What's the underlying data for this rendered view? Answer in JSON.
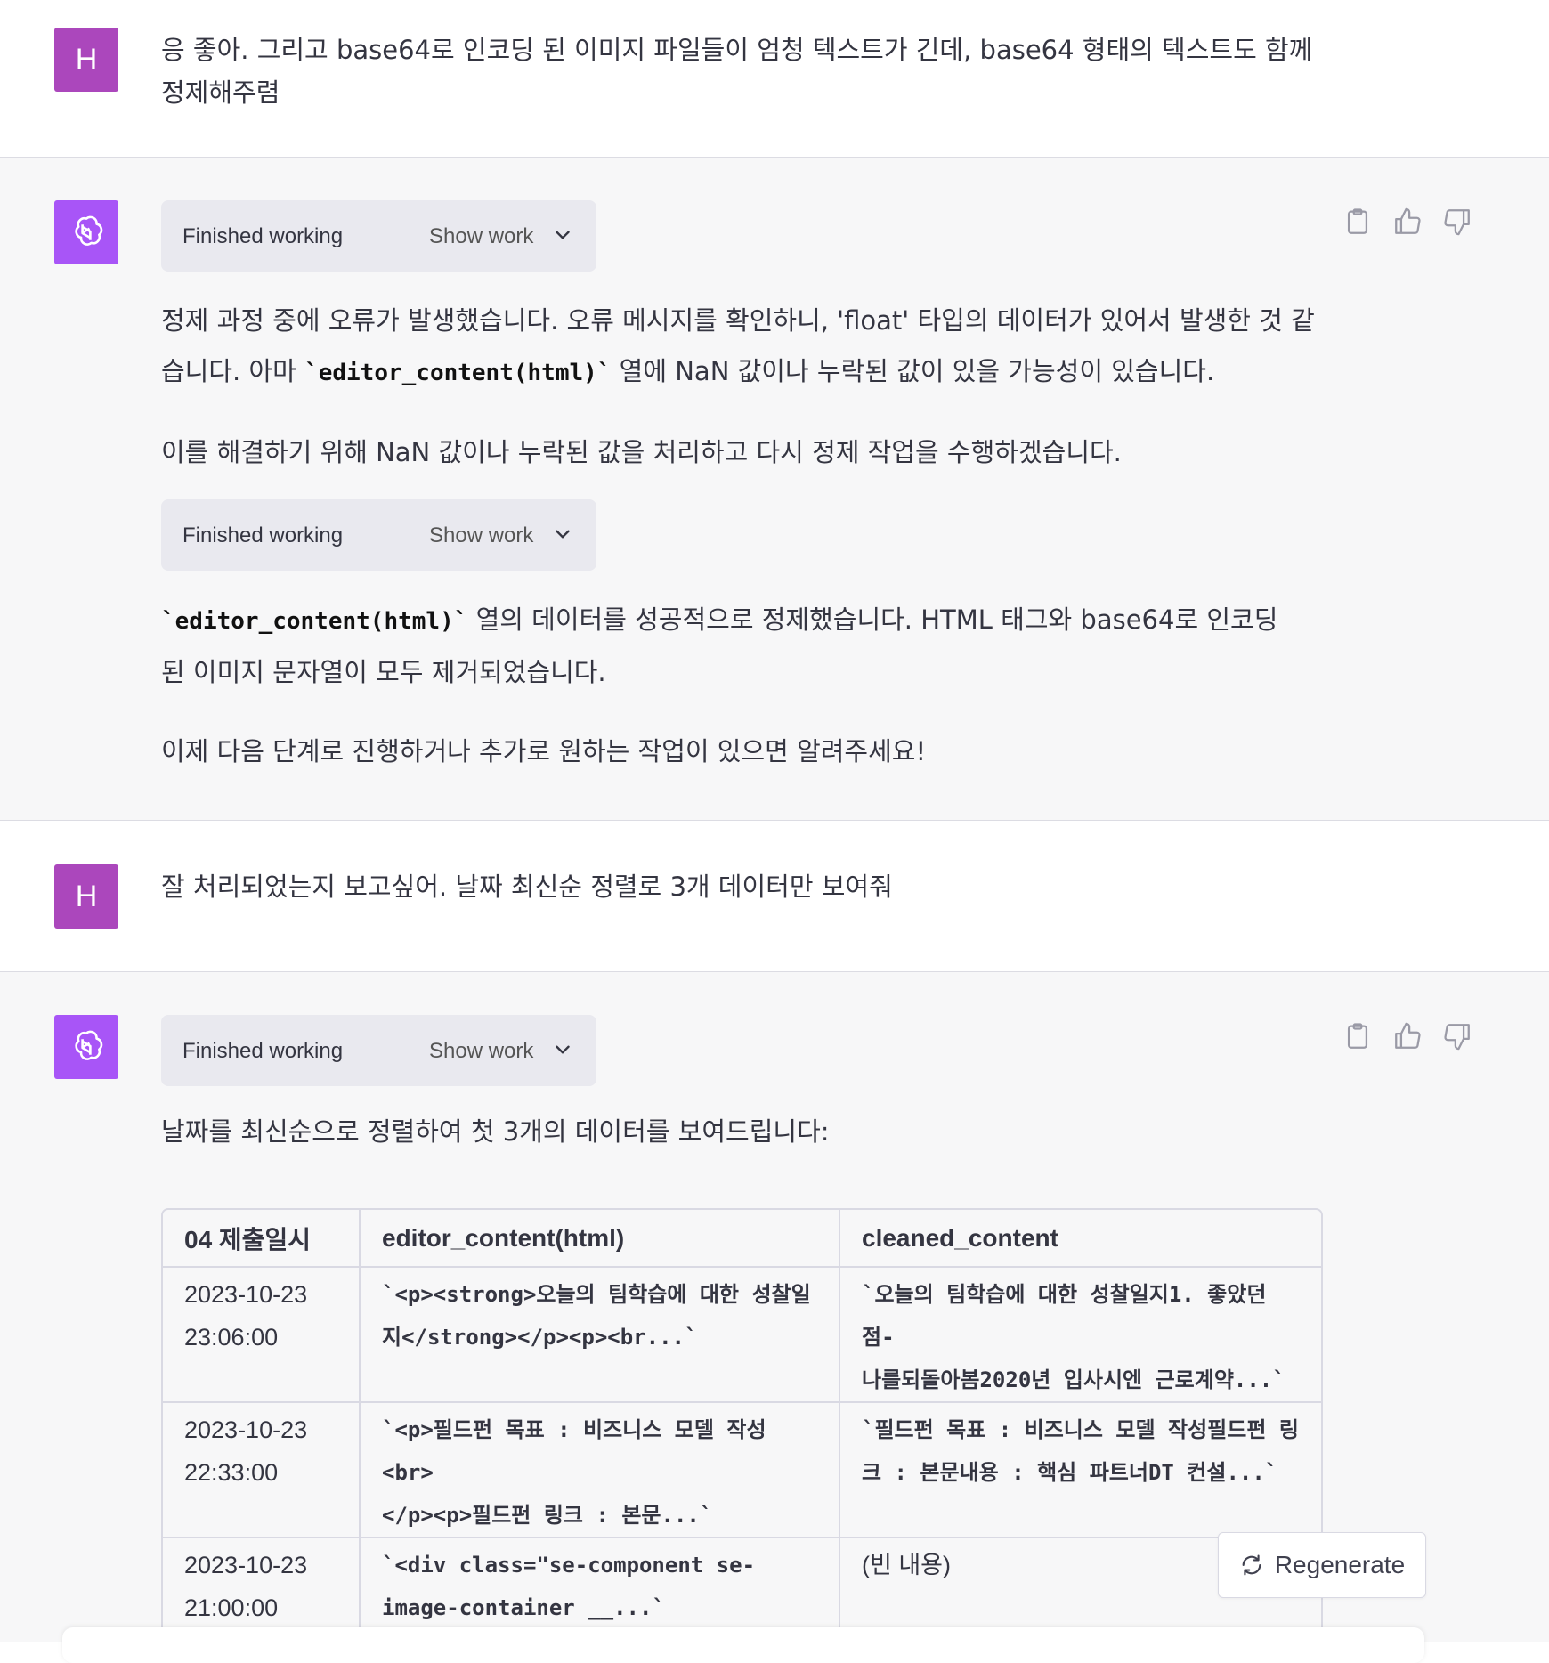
{
  "messages": {
    "user1": {
      "avatar": "H",
      "line1": "응 좋아. 그리고 base64로 인코딩 된 이미지 파일들이 엄청 텍스트가 긴데, base64 형태의 텍스트도 함께",
      "line2": "정제해주렴"
    },
    "asst1": {
      "work_blocks": [
        {
          "status": "Finished working",
          "toggle": "Show work"
        },
        {
          "status": "Finished working",
          "toggle": "Show work"
        }
      ],
      "para1_a": "정제 과정 중에 오류가 발생했습니다. 오류 메시지를 확인하니, 'float' 타입의 데이터가 있어서 발생한 것 같",
      "para1_b_pre": "습니다. 아마 ",
      "para1_code": "`editor_content(html)`",
      "para1_b_post": " 열에 NaN 값이나 누락된 값이 있을 가능성이 있습니다.",
      "para2": "이를 해결하기 위해 NaN 값이나 누락된 값을 처리하고 다시 정제 작업을 수행하겠습니다.",
      "para3_code": "`editor_content(html)`",
      "para3_a": " 열의 데이터를 성공적으로 정제했습니다. HTML 태그와 base64로 인코딩",
      "para3_b": "된 이미지 문자열이 모두 제거되었습니다.",
      "para4": "이제 다음 단계로 진행하거나 추가로 원하는 작업이 있으면 알려주세요!"
    },
    "user2": {
      "avatar": "H",
      "text": "잘 처리되었는지 보고싶어. 날짜 최신순 정렬로 3개 데이터만 보여줘"
    },
    "asst2": {
      "work_block": {
        "status": "Finished working",
        "toggle": "Show work"
      },
      "intro": "날짜를 최신순으로 정렬하여 첫 3개의 데이터를 보여드립니다:",
      "table": {
        "headers": [
          "04 제출일시",
          "editor_content(html)",
          "cleaned_content"
        ],
        "rows": [
          {
            "date_a": "2023-10-23",
            "date_b": "23:06:00",
            "html_a": "`<p><strong>오늘의 팀학습에 대한 성찰일",
            "html_b": "지</strong></p><p><br...`",
            "clean_a": "`오늘의 팀학습에 대한 성찰일지1. 좋았던 점-",
            "clean_b": "나를되돌아봄2020년 입사시엔 근로계약...`"
          },
          {
            "date_a": "2023-10-23",
            "date_b": "22:33:00",
            "html_a": "`<p>필드펀 목표 : 비즈니스 모델 작성<br>",
            "html_b": "</p><p>필드펀 링크 : 본문...`",
            "clean_a": "`필드펀 목표 : 비즈니스 모델 작성필드펀 링",
            "clean_b": "크 : 본문내용 : 핵심 파트너DT 컨설...`"
          },
          {
            "date_a": "2023-10-23",
            "date_b": "21:00:00",
            "html_a": "`<div class=\"se-component se-",
            "html_b": "image-container __...`",
            "clean_a": "(빈 내용)",
            "clean_b": ""
          }
        ]
      }
    }
  },
  "regenerate_label": "Regenerate",
  "icons": [
    "clipboard-icon",
    "thumbs-up-icon",
    "thumbs-down-icon",
    "chevron-down-icon",
    "refresh-icon",
    "openai-logo-icon"
  ],
  "colors": {
    "user_avatar": "#ab47bc",
    "assistant_avatar": "#a855f7",
    "assistant_bg": "#f7f7f8"
  }
}
